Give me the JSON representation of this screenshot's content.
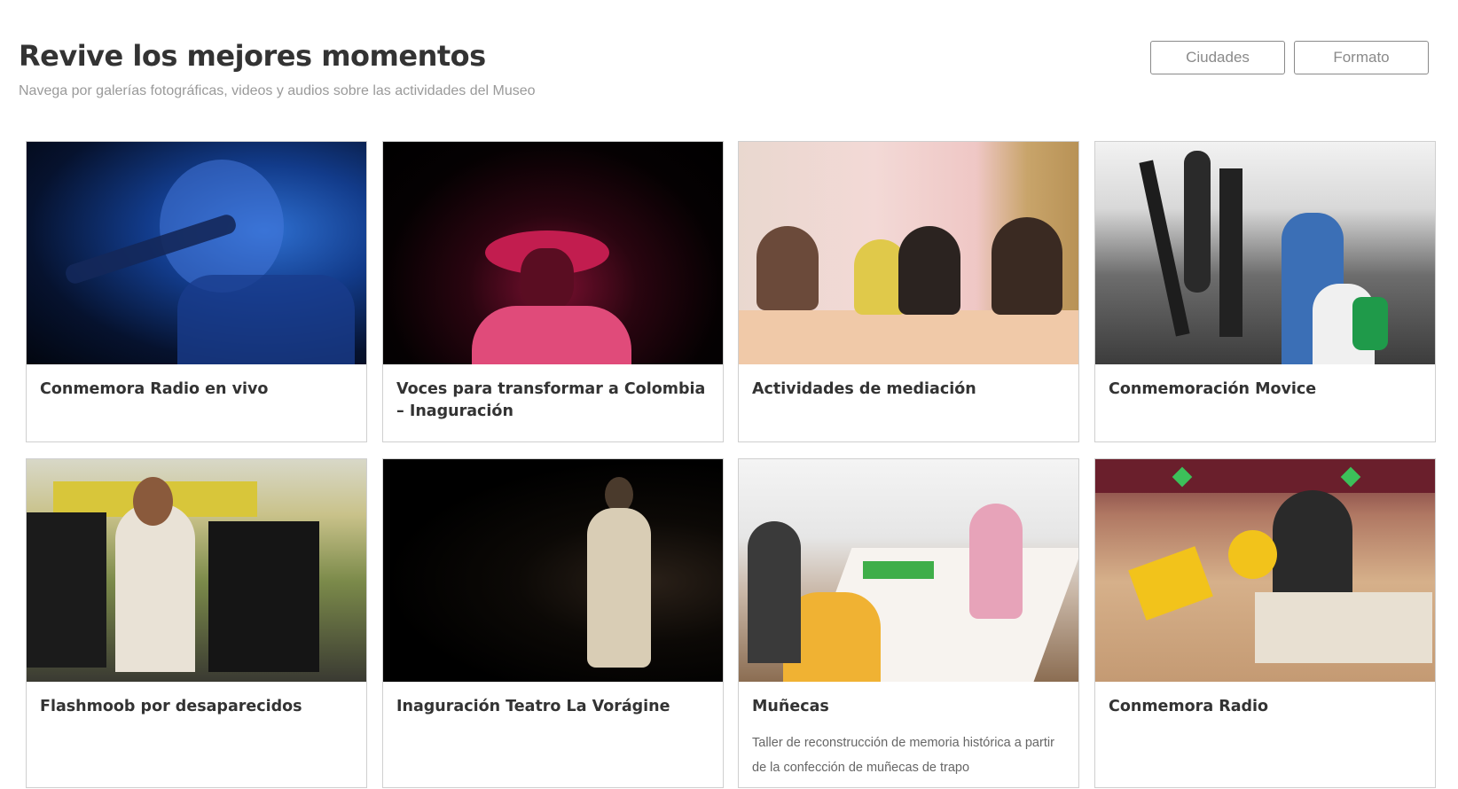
{
  "header": {
    "title": "Revive los mejores momentos",
    "subtitle": "Navega por galerías fotográficas, videos y audios sobre las actividades del Museo"
  },
  "filters": {
    "cities_label": "Ciudades",
    "format_label": "Formato"
  },
  "cards": [
    {
      "title": "Conmemora Radio en vivo",
      "description": ""
    },
    {
      "title": "Voces para transformar a Colombia – Inaguración",
      "description": ""
    },
    {
      "title": "Actividades de mediación",
      "description": ""
    },
    {
      "title": "Conmemoración Movice",
      "description": ""
    },
    {
      "title": "Flashmoob por desaparecidos",
      "description": ""
    },
    {
      "title": "Inaguración Teatro La Vorágine",
      "description": ""
    },
    {
      "title": "Muñecas",
      "description": "Taller de reconstrucción de memoria histórica a partir de la confección de muñecas de trapo"
    },
    {
      "title": "Conmemora Radio",
      "description": ""
    }
  ]
}
